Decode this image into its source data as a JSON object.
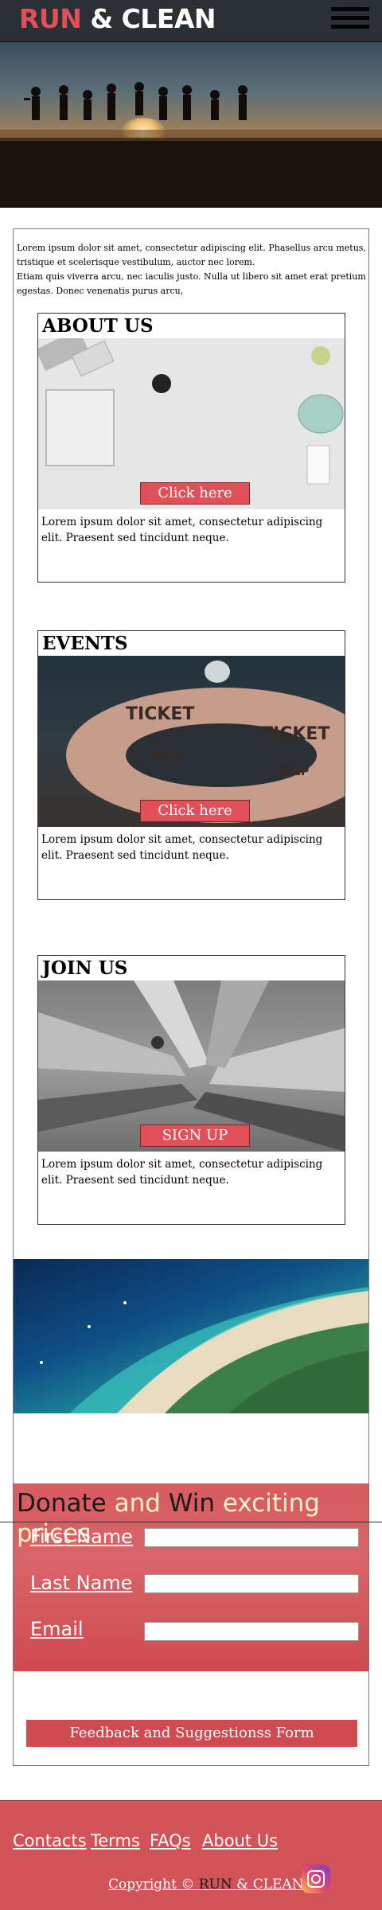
{
  "header": {
    "brand_run": "RUN",
    "brand_rest": " & CLEAN",
    "menu_icon": "hamburger-menu-icon"
  },
  "intro": {
    "line1": "Lorem ipsum dolor sit amet, consectetur adipiscing elit. Phasellus arcu metus, tristique et scelerisque vestibulum, auctor nec lorem.",
    "line2": "Etiam quis viverra arcu, nec iaculis justo. Nulla ut libero sit amet erat pretium egestas. Donec venenatis purus arcu,"
  },
  "cards": [
    {
      "title": "ABOUT US",
      "button": "Click here",
      "text": "Lorem ipsum dolor sit amet, consectetur adipiscing elit. Praesent sed tincidunt neque."
    },
    {
      "title": "EVENTS",
      "button": "Click here",
      "text": "Lorem ipsum dolor sit amet, consectetur adipiscing elit. Praesent sed tincidunt neque."
    },
    {
      "title": "JOIN US",
      "button": "SIGN UP",
      "text": "Lorem ipsum dolor sit amet, consectetur adipiscing elit. Praesent sed tincidunt neque."
    }
  ],
  "donate": {
    "word_donate": "Donate",
    "word_and": " and ",
    "word_win": "Win",
    "word_rest": " exciting prices",
    "fields": [
      {
        "label": "First Name",
        "value": ""
      },
      {
        "label": "Last Name",
        "value": ""
      },
      {
        "label": "Email",
        "value": ""
      }
    ]
  },
  "feedback": {
    "label": "Feedback and Suggestionss Form"
  },
  "footer": {
    "links": [
      "Contacts",
      "Terms",
      "FAQs",
      "About Us"
    ],
    "copyright_prefix": "Copyright © ",
    "copyright_run": "RUN",
    "copyright_rest": " & CLEAN",
    "social_icon": "instagram-icon"
  },
  "colors": {
    "accent": "#d15257",
    "header_bg": "#2b3035",
    "button": "#e05058"
  }
}
